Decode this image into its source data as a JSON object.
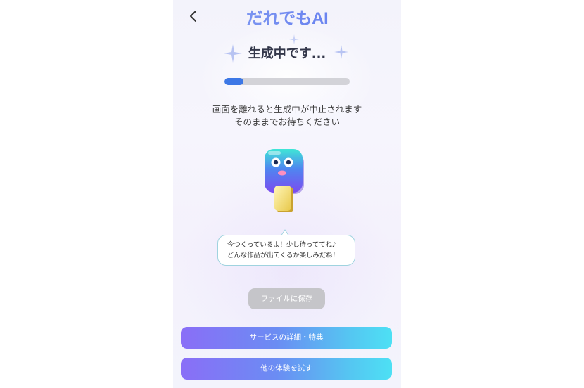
{
  "header": {
    "logo_text": "だれでもAI",
    "back_icon": "chevron-left-icon"
  },
  "status": {
    "title": "生成中です...",
    "progress": 0.15,
    "progress_color": "#3d78e6"
  },
  "notice": {
    "line1": "画面を離れると生成中が中止されます",
    "line2": "そのままでお待ちください"
  },
  "mascot": {
    "icon": "popsicle-mascot-icon"
  },
  "speech_bubble": {
    "line1": "今つくっているよ！少し待っててね♪",
    "line2": "どんな作品が出てくるか楽しみだね！"
  },
  "buttons": {
    "save_file": "ファイルに保存",
    "service_details": "サービスの詳細・特典",
    "try_other": "他の体験を試す"
  },
  "colors": {
    "accent_blue": "#3d78e6",
    "gradient_start": "#8a6ef7",
    "gradient_end": "#4de0f4",
    "disabled_gray": "#c5c5c9"
  }
}
